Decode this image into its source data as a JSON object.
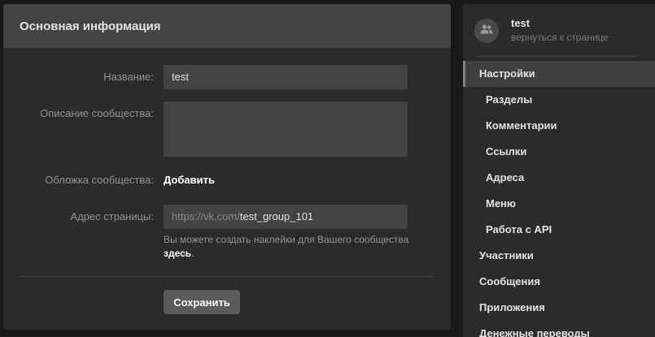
{
  "main": {
    "title": "Основная информация",
    "fields": {
      "name_label": "Название:",
      "name_value": "test",
      "description_label": "Описание сообщества:",
      "description_value": "",
      "cover_label": "Обложка сообщества:",
      "cover_action": "Добавить",
      "address_label": "Адрес страницы:",
      "address_prefix": "https://vk.com/",
      "address_value": "test_group_101",
      "hint_text": "Вы можете создать наклейки для Вашего сообщества",
      "hint_link": "здесь",
      "hint_end": "."
    },
    "save_label": "Сохранить"
  },
  "sidebar": {
    "community_name": "test",
    "community_back": "вернуться к странице",
    "avatar_icon": "people-icon",
    "items": [
      {
        "label": "Настройки",
        "active": true,
        "sub": false
      },
      {
        "label": "Разделы",
        "active": false,
        "sub": true
      },
      {
        "label": "Комментарии",
        "active": false,
        "sub": true
      },
      {
        "label": "Ссылки",
        "active": false,
        "sub": true
      },
      {
        "label": "Адреса",
        "active": false,
        "sub": true
      },
      {
        "label": "Меню",
        "active": false,
        "sub": true
      },
      {
        "label": "Работа с API",
        "active": false,
        "sub": true
      },
      {
        "label": "Участники",
        "active": false,
        "sub": false
      },
      {
        "label": "Сообщения",
        "active": false,
        "sub": false
      },
      {
        "label": "Приложения",
        "active": false,
        "sub": false
      },
      {
        "label": "Денежные переводы",
        "active": false,
        "sub": false
      }
    ]
  },
  "colors": {
    "background": "#19191a",
    "panel": "#2b2b2c",
    "header": "#444445",
    "input": "#434344",
    "button": "#5a5a5b"
  }
}
